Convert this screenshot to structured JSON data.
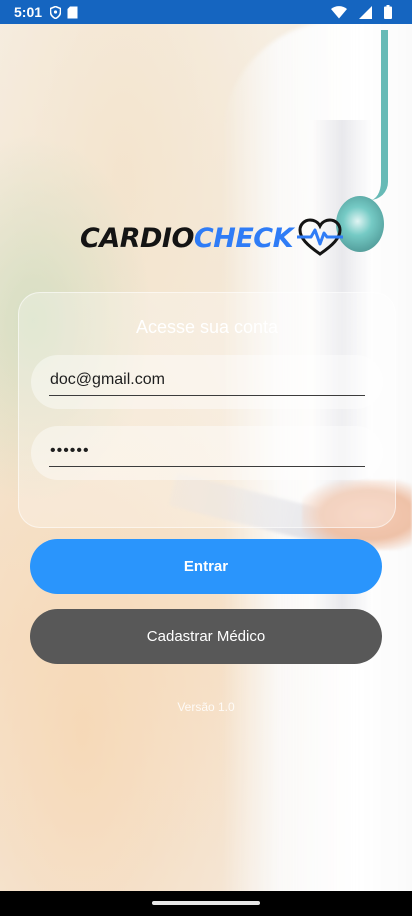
{
  "status_bar": {
    "time": "5:01",
    "icons": [
      "shield-icon",
      "sd-card-icon",
      "wifi-icon",
      "signal-icon",
      "battery-icon"
    ],
    "background": "#1565c0"
  },
  "logo": {
    "part1": "CARDIO",
    "part2": "CHECK",
    "part1_color": "#141414",
    "part2_color": "#2f7cf6",
    "icon": "heart-pulse-icon"
  },
  "login": {
    "title": "Acesse sua conta",
    "email_value": "doc@gmail.com",
    "password_value": "••••••"
  },
  "buttons": {
    "login_label": "Entrar",
    "register_label": "Cadastrar Médico",
    "primary_color": "#2a95fc",
    "secondary_color": "#585858"
  },
  "footer": {
    "version": "Versão 1.0"
  }
}
